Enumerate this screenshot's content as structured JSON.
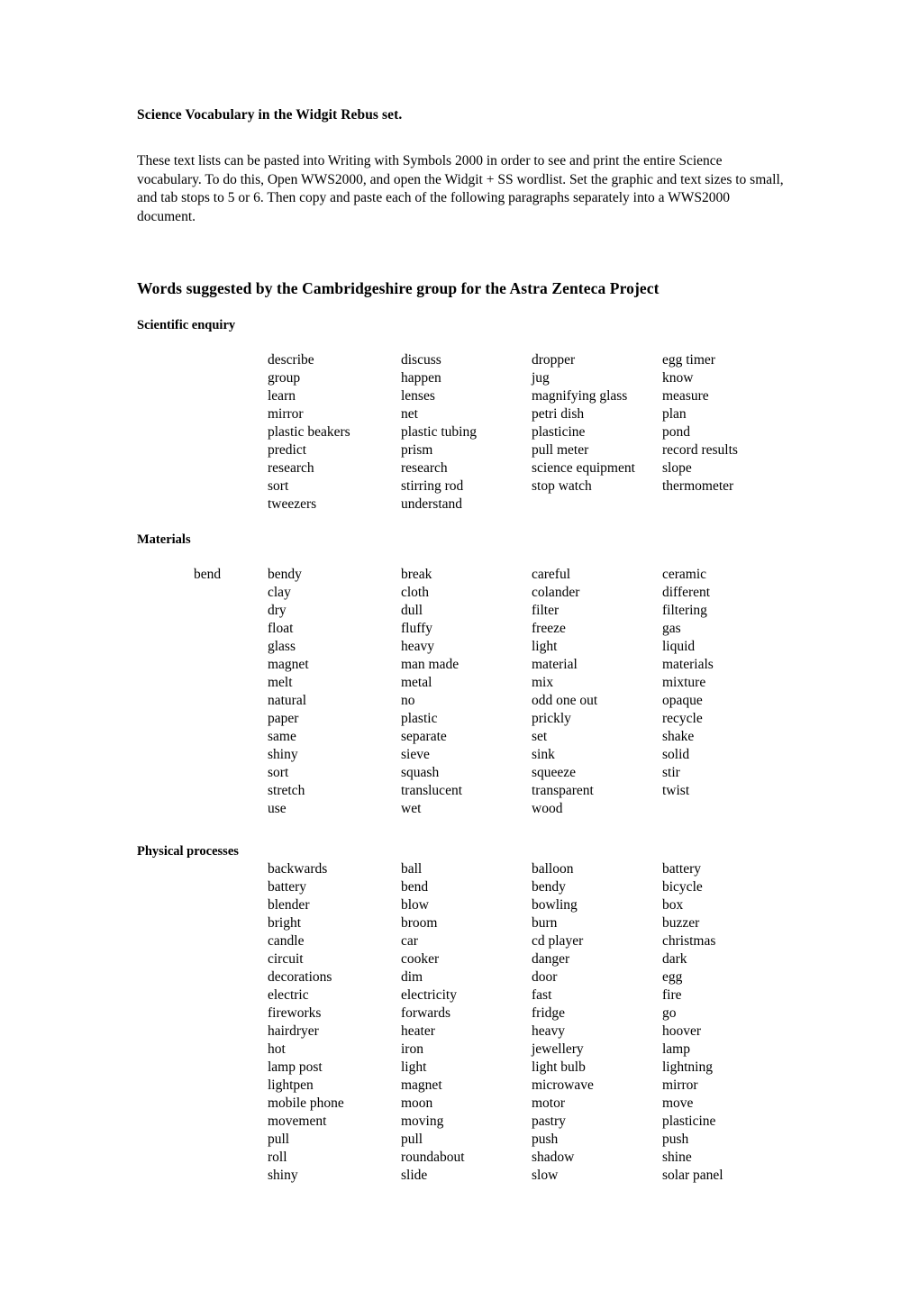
{
  "document": {
    "title": "Science Vocabulary in the Widgit Rebus set.",
    "intro": "These text lists can be pasted into Writing with Symbols 2000 in order to see and print the entire Science vocabulary. To do this, Open WWS2000, and open the Widgit + SS wordlist. Set the graphic and text sizes to small, and tab stops to 5 or 6. Then copy and paste each of the following paragraphs separately into a WWS2000 document.",
    "section_title": "Words suggested by the Cambridgeshire group for the Astra Zenteca Project"
  },
  "groups": [
    {
      "title": "Scientific enquiry",
      "rows": [
        [
          "",
          "describe",
          "discuss",
          "dropper",
          "egg timer"
        ],
        [
          "",
          "group",
          "happen",
          "jug",
          "know"
        ],
        [
          "",
          "learn",
          "lenses",
          "magnifying glass",
          "measure"
        ],
        [
          "",
          "mirror",
          "net",
          "petri dish",
          "plan"
        ],
        [
          "",
          "plastic beakers",
          "plastic tubing",
          "plasticine",
          "pond"
        ],
        [
          "",
          "predict",
          "prism",
          "pull meter",
          "record results"
        ],
        [
          "",
          "research",
          "research",
          "science equipment",
          "slope"
        ],
        [
          "",
          "sort",
          "stirring rod",
          "stop watch",
          "thermometer"
        ],
        [
          "",
          "tweezers",
          "understand",
          "",
          ""
        ]
      ]
    },
    {
      "title": "Materials",
      "rows": [
        [
          "bend",
          "bendy",
          "break",
          "careful",
          "ceramic"
        ],
        [
          "",
          "clay",
          "cloth",
          "colander",
          "different"
        ],
        [
          "",
          "dry",
          "dull",
          "filter",
          "filtering"
        ],
        [
          "",
          "float",
          "fluffy",
          "freeze",
          "gas"
        ],
        [
          "",
          "glass",
          "heavy",
          "light",
          "liquid"
        ],
        [
          "",
          "magnet",
          "man made",
          "material",
          "materials"
        ],
        [
          "",
          "melt",
          "metal",
          "mix",
          "mixture"
        ],
        [
          "",
          "natural",
          "no",
          "odd one out",
          "opaque"
        ],
        [
          "",
          "paper",
          "plastic",
          "prickly",
          "recycle"
        ],
        [
          "",
          "same",
          "separate",
          "set",
          "shake"
        ],
        [
          "",
          "shiny",
          "sieve",
          "sink",
          "solid"
        ],
        [
          "",
          "sort",
          "squash",
          "squeeze",
          "stir"
        ],
        [
          "",
          "stretch",
          "translucent",
          "transparent",
          "twist"
        ],
        [
          "",
          "use",
          "wet",
          "wood",
          ""
        ]
      ]
    },
    {
      "title": "Physical processes",
      "rows": [
        [
          "",
          "backwards",
          "ball",
          "balloon",
          "battery"
        ],
        [
          "",
          "battery",
          "bend",
          "bendy",
          "bicycle"
        ],
        [
          "",
          "blender",
          "blow",
          "bowling",
          "box"
        ],
        [
          "",
          "bright",
          "broom",
          "burn",
          "buzzer"
        ],
        [
          "",
          "candle",
          "car",
          "cd player",
          "christmas"
        ],
        [
          "",
          "circuit",
          "cooker",
          "danger",
          "dark"
        ],
        [
          "",
          "decorations",
          "dim",
          "door",
          "egg"
        ],
        [
          "",
          "electric",
          "electricity",
          "fast",
          "fire"
        ],
        [
          "",
          "fireworks",
          "forwards",
          "fridge",
          "go"
        ],
        [
          "",
          "hairdryer",
          "heater",
          "heavy",
          "hoover"
        ],
        [
          "",
          "hot",
          "iron",
          "jewellery",
          "lamp"
        ],
        [
          "",
          "lamp post",
          "light",
          "light bulb",
          "lightning"
        ],
        [
          "",
          "lightpen",
          "magnet",
          "microwave",
          "mirror"
        ],
        [
          "",
          "mobile phone",
          "moon",
          "motor",
          "move"
        ],
        [
          "",
          "movement",
          "moving",
          "pastry",
          "plasticine"
        ],
        [
          "",
          "pull",
          "pull",
          "push",
          "push"
        ],
        [
          "",
          "roll",
          "roundabout",
          "shadow",
          "shine"
        ],
        [
          "",
          "shiny",
          "slide",
          "slow",
          "solar panel"
        ]
      ]
    }
  ]
}
